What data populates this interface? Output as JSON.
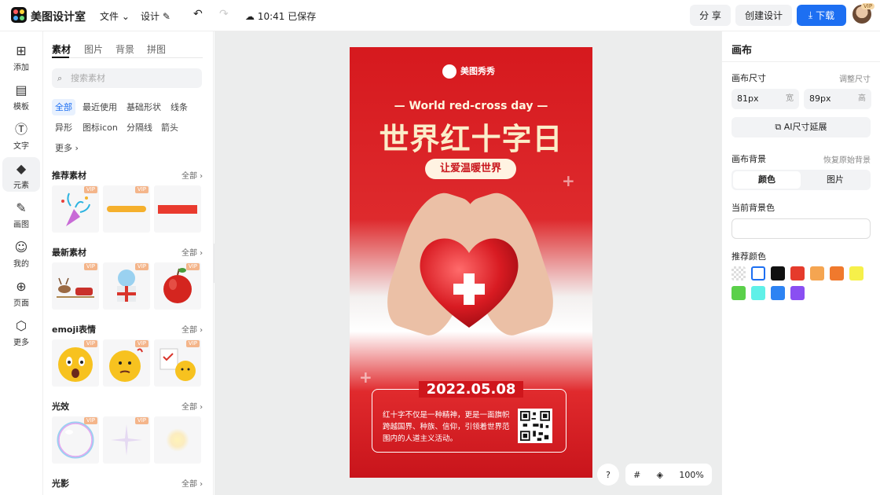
{
  "header": {
    "app_title": "美图设计室",
    "file_menu": "文件",
    "design_menu": "设计",
    "save_status": "10:41 已保存",
    "share_label": "分 享",
    "create_label": "创建设计",
    "download_label": "下载",
    "vip_badge": "VIP"
  },
  "leftnav": {
    "items": [
      {
        "label": "添加",
        "icon": "plus-square-icon"
      },
      {
        "label": "模板",
        "icon": "template-icon"
      },
      {
        "label": "文字",
        "icon": "text-icon"
      },
      {
        "label": "元素",
        "icon": "shapes-icon"
      },
      {
        "label": "画图",
        "icon": "pencil-icon"
      },
      {
        "label": "我的",
        "icon": "user-icon"
      },
      {
        "label": "页面",
        "icon": "page-add-icon"
      },
      {
        "label": "更多",
        "icon": "cube-icon"
      }
    ]
  },
  "panel": {
    "tabs": [
      "素材",
      "图片",
      "背景",
      "拼图"
    ],
    "search_placeholder": "搜索素材",
    "chips": [
      "全部",
      "最近使用",
      "基础形状",
      "线条",
      "异形",
      "图标icon",
      "分隔线",
      "箭头",
      "更多"
    ],
    "all_label": "全部",
    "vip_label": "VIP",
    "sections": [
      "推荐素材",
      "最新素材",
      "emoji表情",
      "光效",
      "光影"
    ]
  },
  "poster": {
    "logo_text": "美图秀秀",
    "subtitle": "World red-cross day",
    "title": "世界红十字日",
    "pill": "让爱温暖世界",
    "date": "2022.05.08",
    "body": "红十字不仅是一种精神，更是一面旗帜跨越国界、种族、信仰，引领着世界范围内的人道主义活动。"
  },
  "right": {
    "title": "画布",
    "size_label": "画布尺寸",
    "adjust_size": "调整尺寸",
    "width_value": "81px",
    "width_unit": "宽",
    "height_value": "89px",
    "height_unit": "高",
    "ai_extend": "AI尺寸延展",
    "bg_label": "画布背景",
    "restore_bg": "恢复原始背景",
    "seg_color": "颜色",
    "seg_image": "图片",
    "current_bg": "当前背景色",
    "recommended": "推荐颜色",
    "swatches": [
      "transparent",
      "#ffffff",
      "#111111",
      "#e53b2c",
      "#f5a551",
      "#f0792d",
      "#f6f04a",
      "#5bd04a",
      "#5ff0e8",
      "#2d83f3",
      "#8a4ff2"
    ]
  },
  "controls": {
    "help": "?",
    "zoom": "100%"
  }
}
